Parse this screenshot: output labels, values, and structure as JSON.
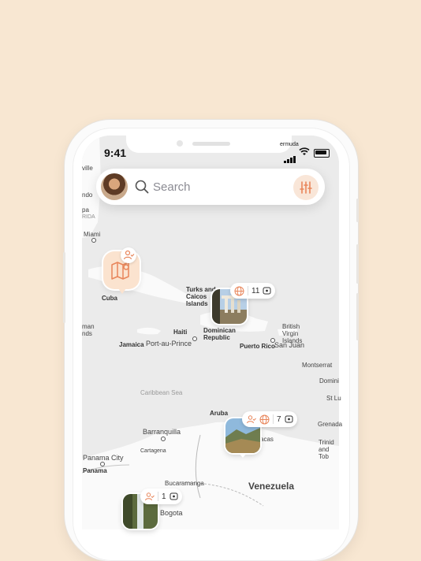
{
  "status_bar": {
    "time": "9:41",
    "carrier": "ermuda"
  },
  "search": {
    "placeholder": "Search"
  },
  "colors": {
    "accent": "#e8855a",
    "background": "#f8e7d2"
  },
  "map_labels": {
    "ville": "ville",
    "ndo": "ndo",
    "pa": "pa",
    "rida": "RIDA",
    "miami": "Miami",
    "cuba": "Cuba",
    "turks_caicos": "Turks and Caicos Islands",
    "haiti": "Haiti",
    "dominican_republic": "Dominican Republic",
    "bvi": "British Virgin Islands",
    "jamaica": "Jamaica",
    "port_au_prince": "Port-au-Prince",
    "puerto_rico": "Puerto Rico",
    "san_juan": "San Juan",
    "cayman": "man nds",
    "montserrat": "Montserrat",
    "domini": "Domini",
    "st_lu": "St Lu",
    "caribbean_sea": "Caribbean Sea",
    "aruba": "Aruba",
    "grenada": "Grenada",
    "barranquilla": "Barranquilla",
    "cartagena": "Cartagena",
    "caracas": "acas",
    "trinidad": "Trinid and Tob",
    "panama_city": "Panama City",
    "panama": "Panama",
    "bucaramanga": "Bucaramanga",
    "venezuela": "Venezuela",
    "bogota": "Bogota"
  },
  "markers": [
    {
      "name": "cuba-collection",
      "icon": "map-pin-icon",
      "badge": "person-check-icon"
    },
    {
      "name": "dominican-republic-photo",
      "icons": [
        "globe-icon"
      ],
      "count": "11",
      "count_icon": "chat-star-icon"
    },
    {
      "name": "venezuela-photo",
      "icons": [
        "person-check-icon",
        "globe-icon"
      ],
      "count": "7",
      "count_icon": "chat-star-icon"
    },
    {
      "name": "colombia-photo",
      "icons": [
        "person-check-icon"
      ],
      "count": "1",
      "count_icon": "chat-star-icon"
    }
  ]
}
